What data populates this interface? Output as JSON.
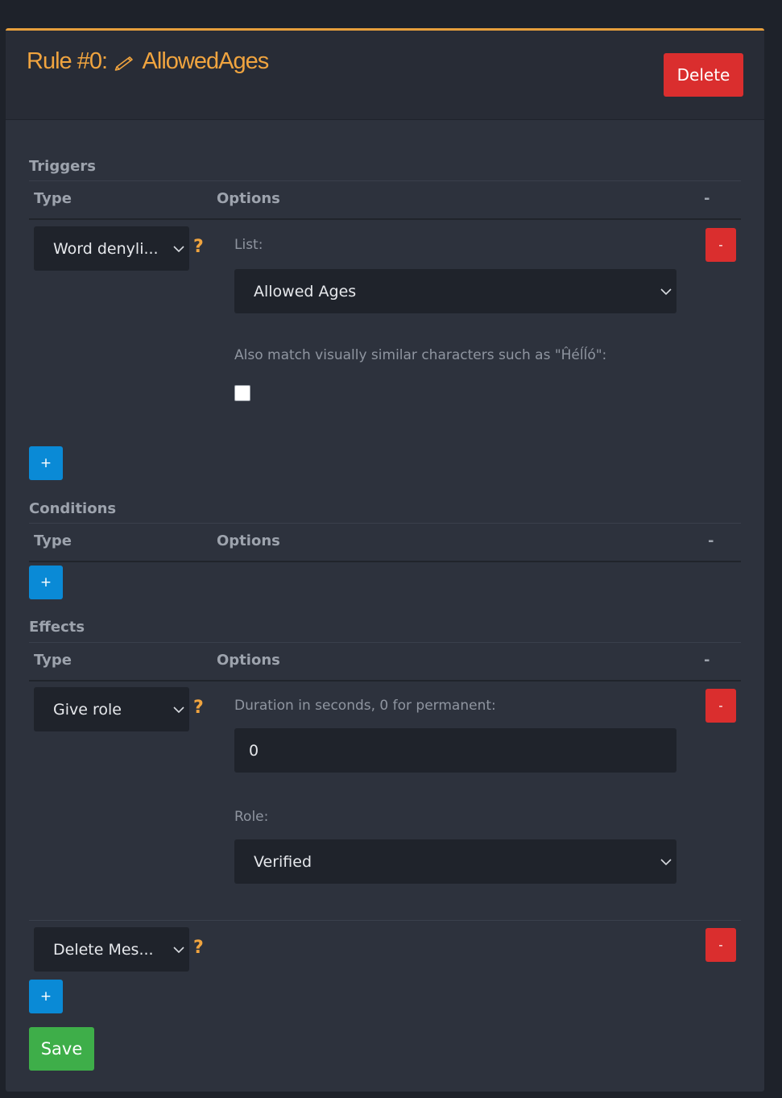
{
  "rule": {
    "title_prefix": "Rule #0:",
    "name": "AllowedAges",
    "delete_label": "Delete"
  },
  "columns": {
    "type": "Type",
    "options": "Options",
    "remove": "-"
  },
  "triggers": {
    "label": "Triggers",
    "items": [
      {
        "type_value": "Word denyli...",
        "list_label": "List:",
        "list_value": "Allowed Ages",
        "similar_label": "Also match visually similar characters such as \"Ĥéĺĺó\":",
        "similar_checked": false
      }
    ]
  },
  "conditions": {
    "label": "Conditions"
  },
  "effects": {
    "label": "Effects",
    "items": [
      {
        "type_value": "Give role",
        "duration_label": "Duration in seconds, 0 for permanent:",
        "duration_value": "0",
        "role_label": "Role:",
        "role_value": "Verified"
      },
      {
        "type_value": "Delete Mes..."
      }
    ]
  },
  "buttons": {
    "minus": "-",
    "plus": "+",
    "save": "Save",
    "help": "?"
  },
  "icons": {
    "pencil": "pencil-icon",
    "chevron": "chevron-down-icon",
    "help": "help-icon"
  },
  "colors": {
    "accent": "#f0a43f",
    "danger": "#da2e2e",
    "primary": "#0a8ad6",
    "success": "#3eae49",
    "card_bg": "#2d323d"
  }
}
